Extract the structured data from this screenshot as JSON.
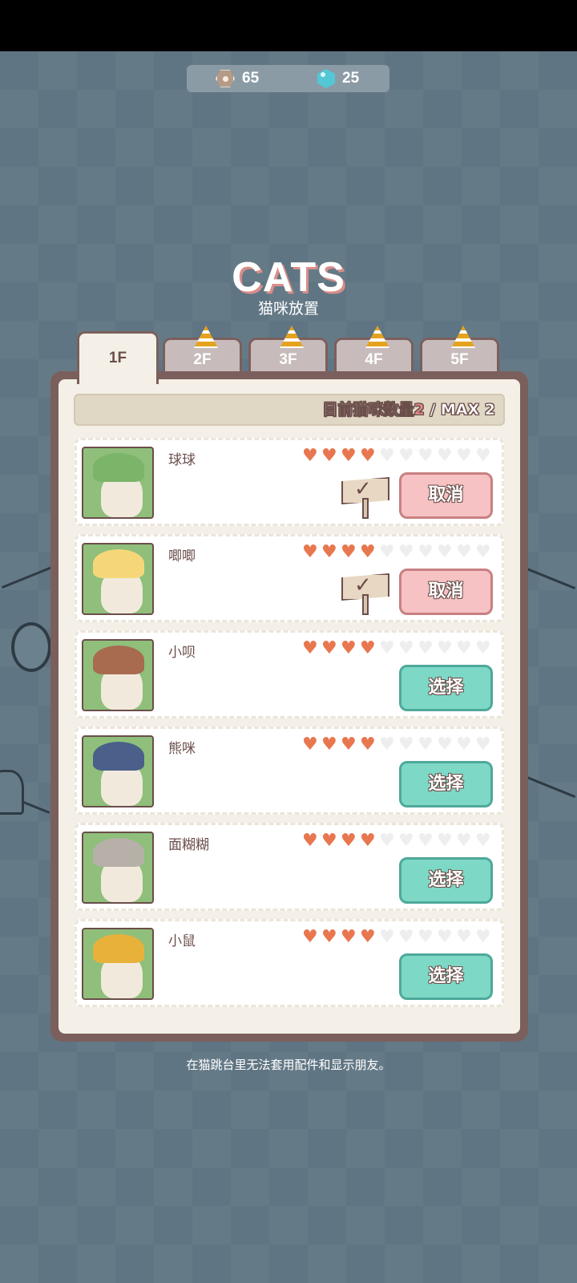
{
  "currency": {
    "nuts": "65",
    "gems": "25"
  },
  "header": {
    "title": "CATS",
    "subtitle": "猫咪放置"
  },
  "tabs": [
    {
      "label": "1F",
      "locked": false
    },
    {
      "label": "2F",
      "locked": true
    },
    {
      "label": "3F",
      "locked": true
    },
    {
      "label": "4F",
      "locked": true
    },
    {
      "label": "5F",
      "locked": true
    }
  ],
  "count": {
    "label": "目前猫咪数量",
    "current": "2",
    "max": " / MAX 2"
  },
  "cats": [
    {
      "name": "球球",
      "hearts_filled": 4,
      "hearts_total": 10,
      "placed": true,
      "button": "取消",
      "hat_color": "#7bb56a"
    },
    {
      "name": "唧唧",
      "hearts_filled": 4,
      "hearts_total": 10,
      "placed": true,
      "button": "取消",
      "hat_color": "#f5d77a"
    },
    {
      "name": "小呗",
      "hearts_filled": 4,
      "hearts_total": 10,
      "placed": false,
      "button": "选择",
      "hat_color": "#a86b4f"
    },
    {
      "name": "熊咪",
      "hearts_filled": 4,
      "hearts_total": 10,
      "placed": false,
      "button": "选择",
      "hat_color": "#4a5f8a"
    },
    {
      "name": "面糊糊",
      "hearts_filled": 4,
      "hearts_total": 10,
      "placed": false,
      "button": "选择",
      "hat_color": "#b6b0a8"
    },
    {
      "name": "小鼠",
      "hearts_filled": 4,
      "hearts_total": 10,
      "placed": false,
      "button": "选择",
      "hat_color": "#e8b23a"
    }
  ],
  "footer": {
    "note": "在猫跳台里无法套用配件和显示朋友。"
  },
  "colors": {
    "accent_cancel": "#f6c2c3",
    "accent_select": "#7ed8c6",
    "heart": "#e8774f"
  }
}
